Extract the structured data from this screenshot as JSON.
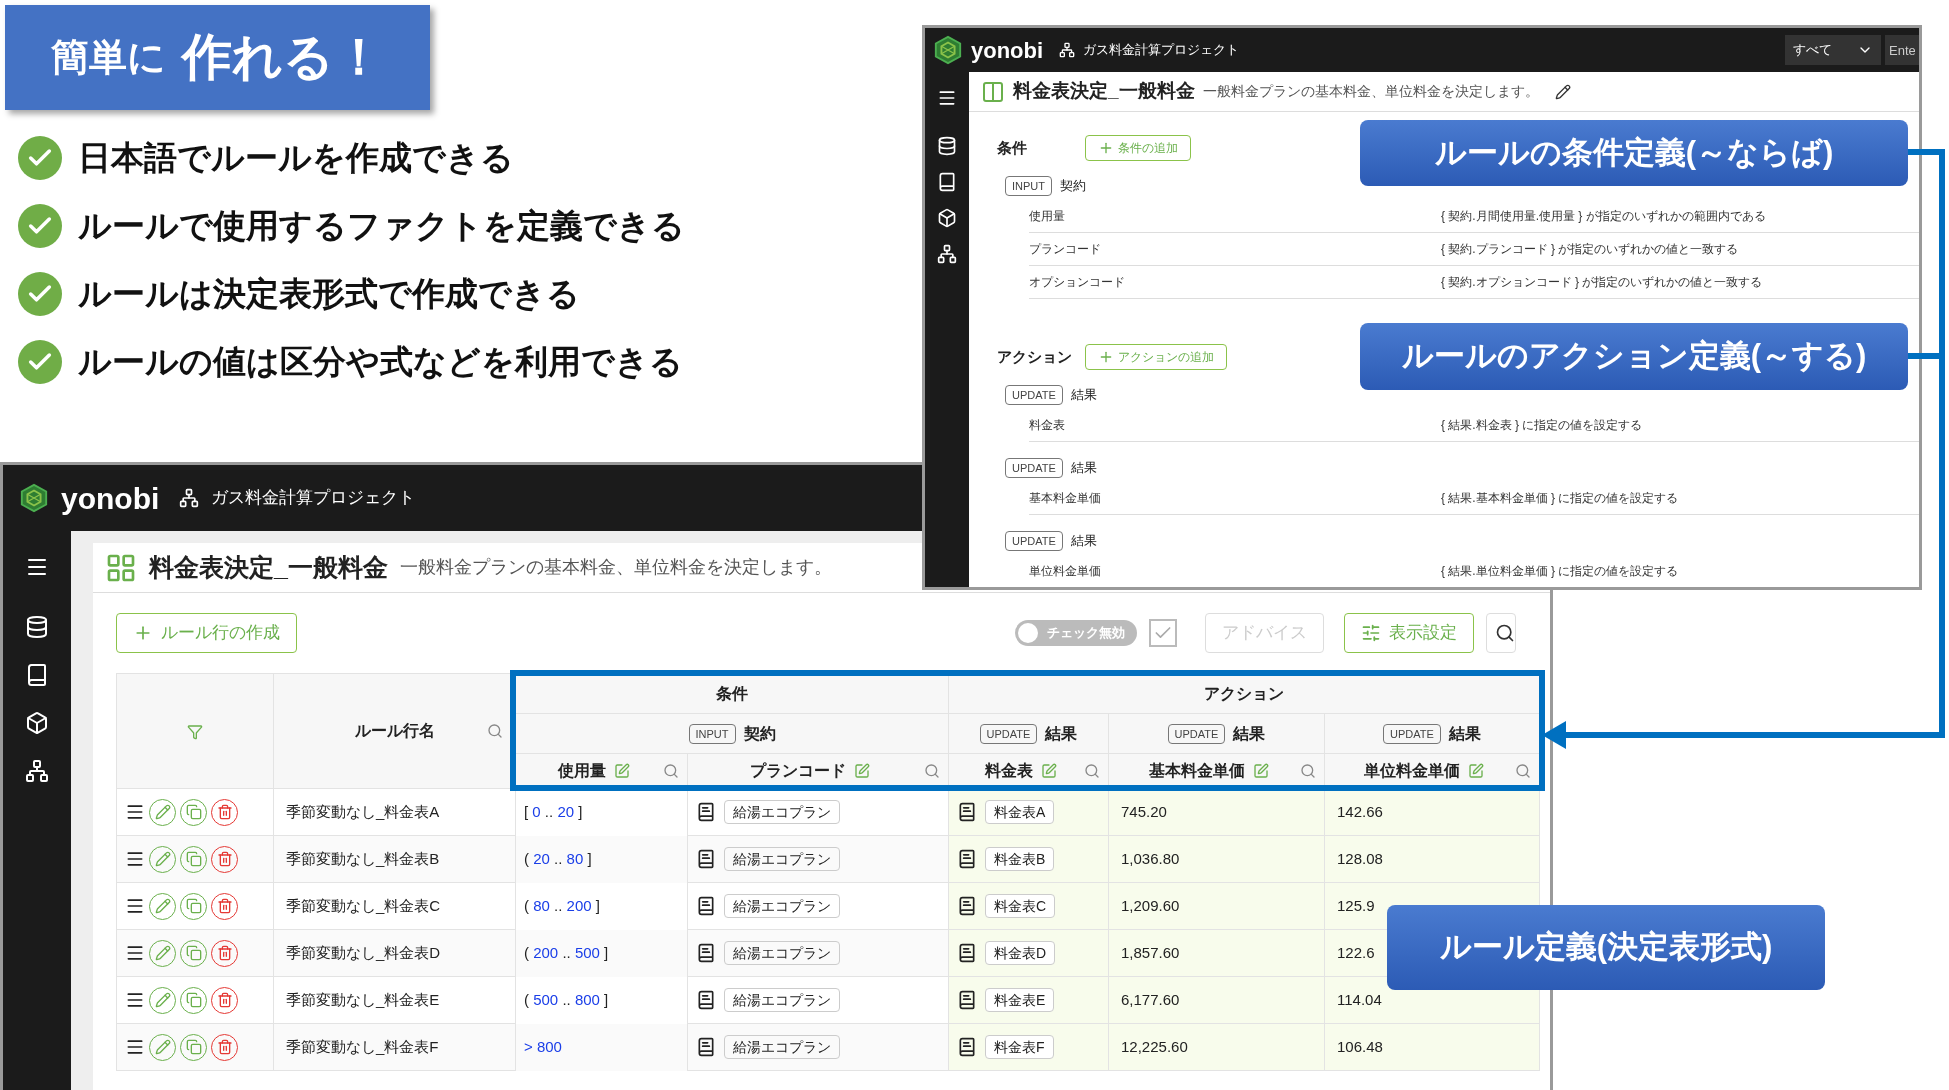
{
  "slide": {
    "title_lead": "簡単に",
    "title_main": "作れる！",
    "bullets": [
      "日本語でルールを作成できる",
      "ルールで使用するファクトを定義できる",
      "ルールは決定表形式で作成できる",
      "ルールの値は区分や式などを利用できる"
    ]
  },
  "rule_window": {
    "app_name": "yonobi",
    "project": "ガス料金計算プロジェクト",
    "scope_select": "すべて",
    "search_field": {
      "placeholder": "Ente"
    },
    "page_title": "料金表決定_一般料金",
    "description": "一般料金プランの基本料金、単位料金を決定します。",
    "sections": [
      {
        "label": "条件",
        "add_button": "条件の追加",
        "groups": [
          {
            "tag": "INPUT",
            "fact": "契約",
            "rows": [
              {
                "name": "使用量",
                "rule": "{ 契約.月間使用量.使用量 } が指定のいずれかの範囲内である"
              },
              {
                "name": "プランコード",
                "rule": "{ 契約.プランコード } が指定のいずれかの値と一致する"
              },
              {
                "name": "オプションコード",
                "rule": "{ 契約.オプションコード } が指定のいずれかの値と一致する"
              }
            ]
          }
        ]
      },
      {
        "label": "アクション",
        "add_button": "アクションの追加",
        "groups": [
          {
            "tag": "UPDATE",
            "fact": "結果",
            "rows": [
              {
                "name": "料金表",
                "rule": "{ 結果.料金表 } に指定の値を設定する"
              }
            ]
          },
          {
            "tag": "UPDATE",
            "fact": "結果",
            "rows": [
              {
                "name": "基本料金単価",
                "rule": "{ 結果.基本料金単価 } に指定の値を設定する"
              }
            ]
          },
          {
            "tag": "UPDATE",
            "fact": "結果",
            "rows": [
              {
                "name": "単位料金単価",
                "rule": "{ 結果.単位料金単価 } に指定の値を設定する"
              }
            ]
          }
        ]
      }
    ]
  },
  "table_window": {
    "app_name": "yonobi",
    "project": "ガス料金計算プロジェクト",
    "page_title": "料金表決定_一般料金",
    "description": "一般料金プランの基本料金、単位料金を決定します。",
    "toolbar": {
      "create_button": "ルール行の作成",
      "check_toggle": {
        "label": "チェック無効",
        "on": false
      },
      "check_box": {
        "checked": true
      },
      "advice_button": {
        "label": "アドバイス",
        "disabled": true
      },
      "display_button": "表示設定"
    },
    "table": {
      "name_column": "ルール行名",
      "groups": [
        {
          "label": "条件",
          "facts": [
            {
              "tag": "INPUT",
              "fact": "契約",
              "columns": [
                "使用量",
                "プランコード"
              ]
            }
          ]
        },
        {
          "label": "アクション",
          "facts": [
            {
              "tag": "UPDATE",
              "fact": "結果",
              "columns": [
                "料金表"
              ]
            },
            {
              "tag": "UPDATE",
              "fact": "結果",
              "columns": [
                "基本料金単価"
              ]
            },
            {
              "tag": "UPDATE",
              "fact": "結果",
              "columns": [
                "単位料金単価"
              ]
            }
          ]
        }
      ],
      "rows": [
        {
          "name": "季節変動なし_料金表A",
          "range": {
            "kind": "interval",
            "open": "[",
            "low": "0",
            "sep": "..",
            "high": "20",
            "close": "]"
          },
          "plan": "給湯エコプラン",
          "rate_table": "料金表A",
          "base": "745.20",
          "unit": "142.66"
        },
        {
          "name": "季節変動なし_料金表B",
          "range": {
            "kind": "interval",
            "open": "(",
            "low": "20",
            "sep": "..",
            "high": "80",
            "close": "]"
          },
          "plan": "給湯エコプラン",
          "rate_table": "料金表B",
          "base": "1,036.80",
          "unit": "128.08"
        },
        {
          "name": "季節変動なし_料金表C",
          "range": {
            "kind": "interval",
            "open": "(",
            "low": "80",
            "sep": "..",
            "high": "200",
            "close": "]"
          },
          "plan": "給湯エコプラン",
          "rate_table": "料金表C",
          "base": "1,209.60",
          "unit": "125.9"
        },
        {
          "name": "季節変動なし_料金表D",
          "range": {
            "kind": "interval",
            "open": "(",
            "low": "200",
            "sep": "..",
            "high": "500",
            "close": "]"
          },
          "plan": "給湯エコプラン",
          "rate_table": "料金表D",
          "base": "1,857.60",
          "unit": "122.6"
        },
        {
          "name": "季節変動なし_料金表E",
          "range": {
            "kind": "interval",
            "open": "(",
            "low": "500",
            "sep": "..",
            "high": "800",
            "close": "]"
          },
          "plan": "給湯エコプラン",
          "rate_table": "料金表E",
          "base": "6,177.60",
          "unit": "114.04"
        },
        {
          "name": "季節変動なし_料金表F",
          "range": {
            "kind": "greater",
            "text": "> 800"
          },
          "plan": "給湯エコプラン",
          "rate_table": "料金表F",
          "base": "12,225.60",
          "unit": "106.48"
        }
      ]
    }
  },
  "callouts": [
    "ルールの条件定義(～ならば)",
    "ルールのアクション定義(～する)",
    "ルール定義(決定表形式)"
  ]
}
